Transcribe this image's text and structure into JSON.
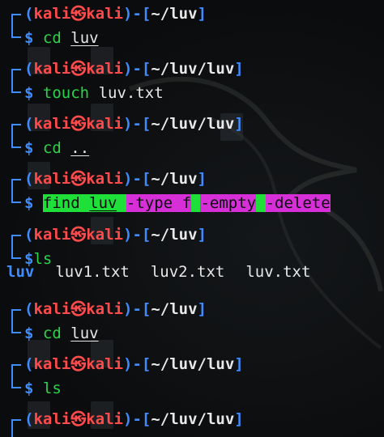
{
  "prompt": {
    "user": "kali",
    "at_symbol": "㉿",
    "host": "kali",
    "open": "(",
    "close": ")-[",
    "close_end": "]",
    "dollar": "$"
  },
  "blocks": [
    {
      "path": "~/luv",
      "command": "cd",
      "arg": "luv"
    },
    {
      "path": "~/luv/luv",
      "command": "touch",
      "arg": "luv.txt"
    },
    {
      "path": "~/luv/luv",
      "command": "cd",
      "arg": ".."
    },
    {
      "path": "~/luv",
      "command": "find",
      "parts": [
        "luv",
        "-type",
        "f",
        "-empty",
        "-delete"
      ]
    },
    {
      "path": "~/luv",
      "command": "ls",
      "arg": ""
    },
    {
      "path": "~/luv",
      "command": "cd",
      "arg": "luv"
    },
    {
      "path": "~/luv/luv",
      "command": "ls",
      "arg": ""
    },
    {
      "path": "~/luv/luv",
      "command": "",
      "arg": ""
    }
  ],
  "ls_output": {
    "items": [
      {
        "name": "luv",
        "kind": "directory"
      },
      {
        "name": "luv1.txt",
        "kind": "file"
      },
      {
        "name": "luv2.txt",
        "kind": "file"
      },
      {
        "name": "luv.txt",
        "kind": "file"
      }
    ]
  },
  "colors": {
    "prompt_blue": "#3f8cff",
    "prompt_red": "#ff4b4b",
    "command_green": "#2cd34a",
    "highlight_green": "#1fe039",
    "highlight_magenta": "#d62fd8",
    "background": "#0b0c0d"
  }
}
